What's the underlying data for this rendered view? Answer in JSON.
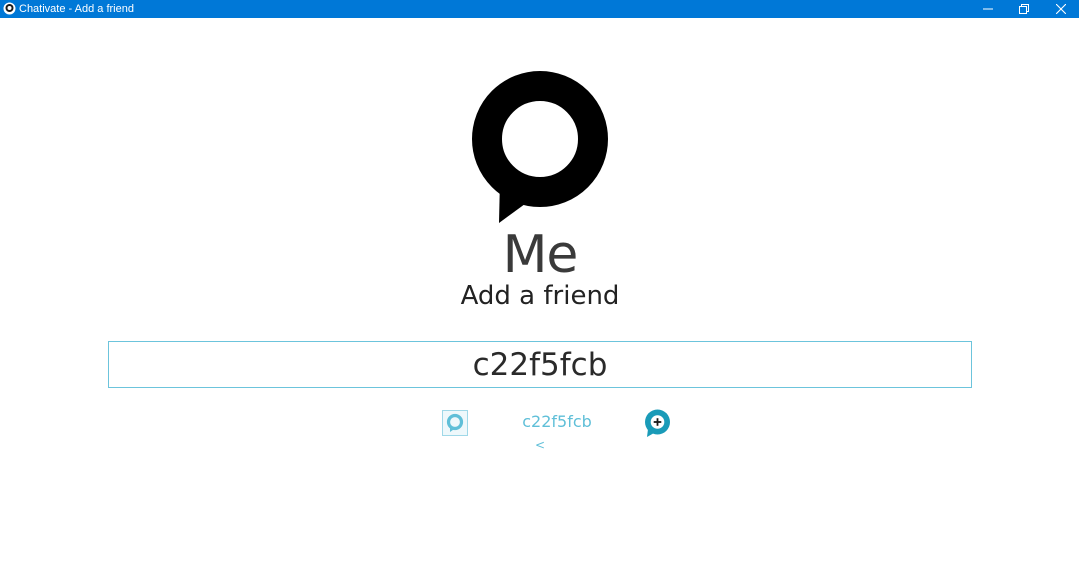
{
  "window": {
    "title": "Chativate - Add a friend"
  },
  "colors": {
    "titlebar": "#0078d7",
    "accent": "#1a9bb8",
    "accent_light": "#5fbfd8",
    "input_border": "#6cc4dc"
  },
  "icons": {
    "app": "chativate-app-icon",
    "minimize": "minimize-icon",
    "maximize": "restore-icon",
    "close": "close-icon",
    "logo": "chat-bubble-logo",
    "avatar": "chat-bubble-icon",
    "add": "add-chat-icon"
  },
  "header": {
    "name": "Me",
    "subtitle": "Add a friend"
  },
  "search": {
    "value": "c22f5fcb"
  },
  "result": {
    "friend_id": "c22f5fcb",
    "back_label": "<"
  }
}
